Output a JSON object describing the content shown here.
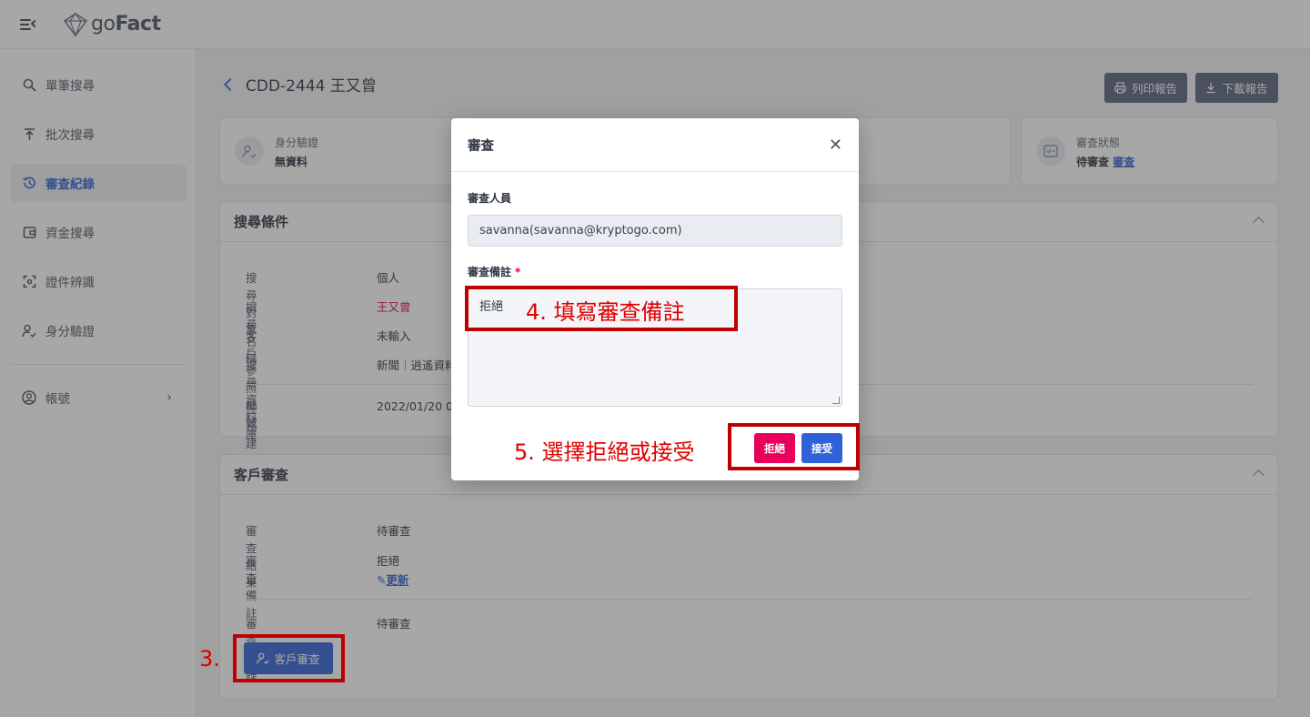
{
  "header": {
    "logo_text_light": "go",
    "logo_text_bold": "Fact"
  },
  "sidebar": {
    "items": [
      {
        "label": "單筆搜尋",
        "icon": "search-icon"
      },
      {
        "label": "批次搜尋",
        "icon": "upload-icon"
      },
      {
        "label": "審查紀錄",
        "icon": "history-icon",
        "active": true
      },
      {
        "label": "資金搜尋",
        "icon": "wallet-icon"
      },
      {
        "label": "證件辨識",
        "icon": "scan-icon"
      },
      {
        "label": "身分驗證",
        "icon": "user-check-icon"
      }
    ],
    "account": {
      "label": "帳號",
      "icon": "user-circle-icon"
    }
  },
  "page": {
    "title": "CDD-2444 王又曾",
    "print_label": "列印報告",
    "download_label": "下載報告"
  },
  "stats": {
    "identity": {
      "label": "身分驗證",
      "value": "無資料"
    },
    "review_status": {
      "label": "審查狀態",
      "value": "待審查",
      "link": "審查"
    }
  },
  "search_conditions": {
    "title": "搜尋條件",
    "rows": [
      {
        "key": "搜尋對象",
        "value": "個人"
      },
      {
        "key": "搜尋名稱",
        "value": "王又曾"
      },
      {
        "key": "客戶參照編號",
        "value": "未輸入"
      },
      {
        "key": "搜尋資料庫",
        "value": "新聞｜逍遙資料"
      }
    ],
    "created_key": "任務建立紀錄",
    "created_value": "2022/01/20 00"
  },
  "customer_review": {
    "title": "客戶審查",
    "result_key": "審查結果",
    "result_value": "待審查",
    "note_key": "審查備註",
    "note_value": "拒絕",
    "update_link": "更新",
    "log_key": "審查紀錄",
    "log_value": "待審查",
    "button_label": "客戶審查"
  },
  "modal": {
    "title": "審查",
    "reviewer_label": "審查人員",
    "reviewer_value": "savanna(savanna@kryptogo.com)",
    "note_label": "審查備註",
    "required_mark": "*",
    "note_value": "拒絕",
    "reject_label": "拒絕",
    "accept_label": "接受"
  },
  "annotations": {
    "step3": "3.",
    "step4": "4. 填寫審查備註",
    "step5": "5. 選擇拒絕或接受"
  },
  "colors": {
    "primary": "#2f62d6",
    "danger": "#e8005a",
    "annotation": "#e00000",
    "highlight_name": "#e4002b"
  }
}
